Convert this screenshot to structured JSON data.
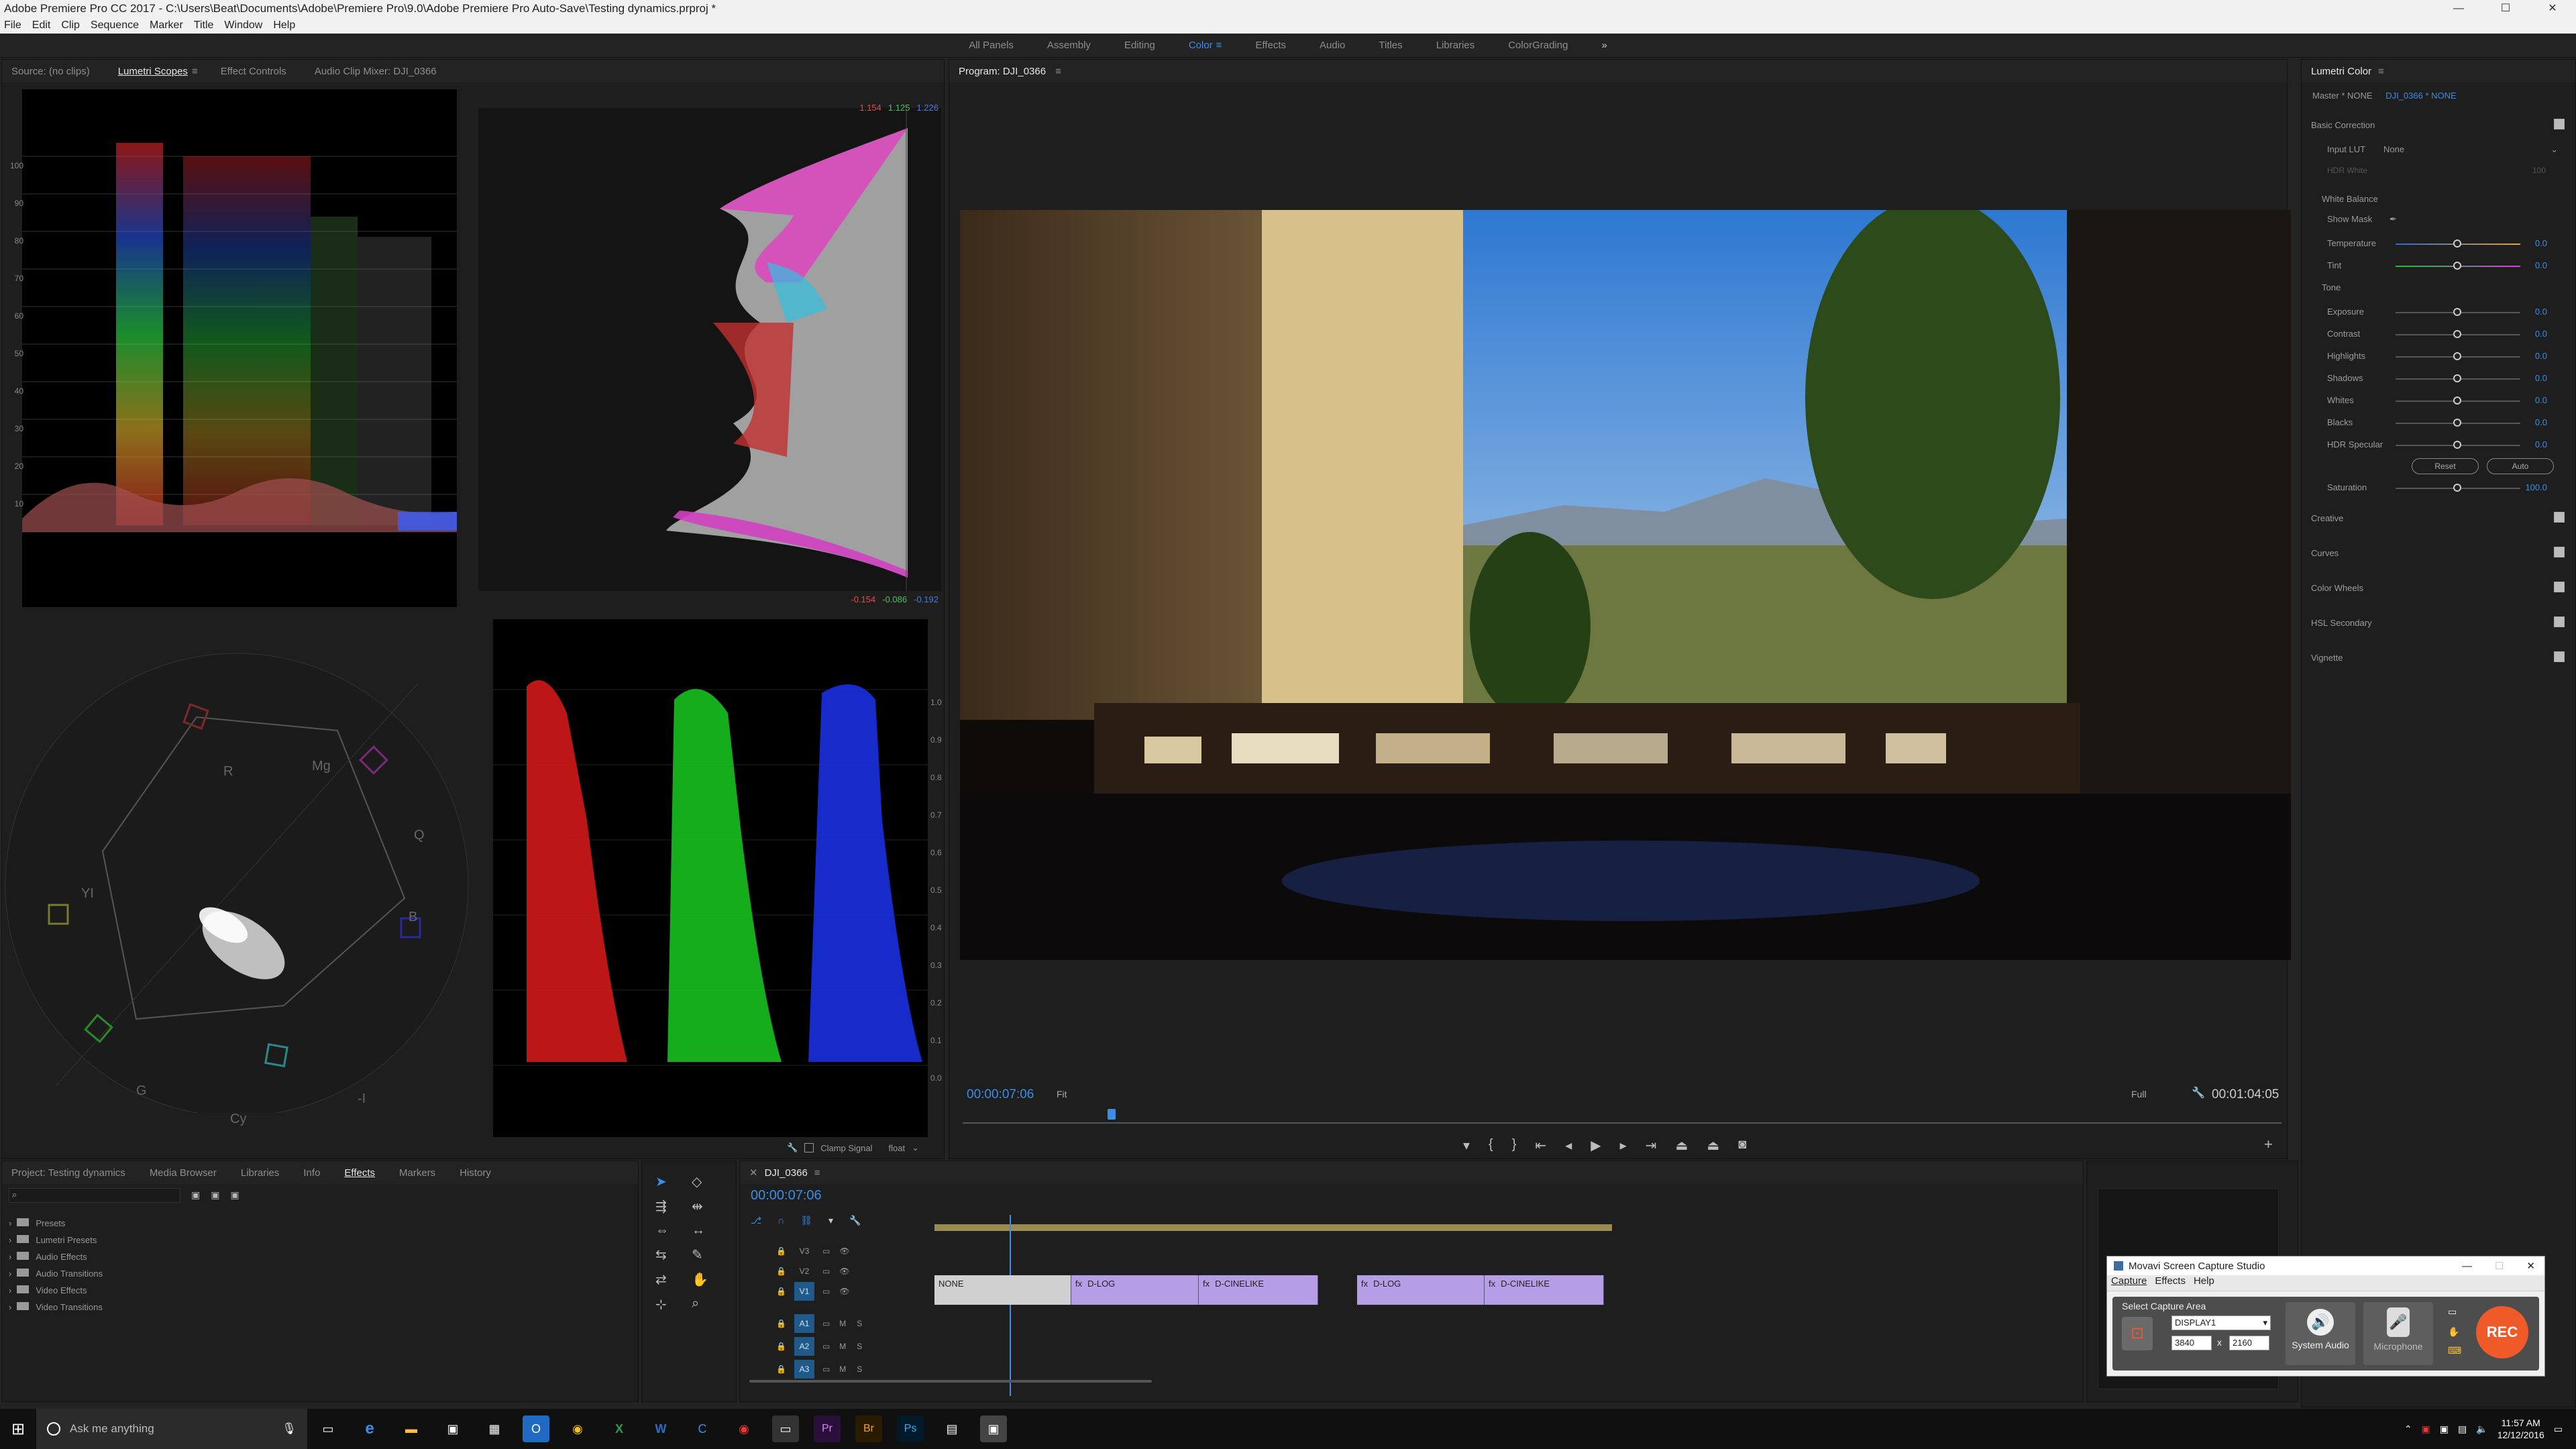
{
  "window": {
    "title": "Adobe Premiere Pro CC 2017 - C:\\Users\\Beat\\Documents\\Adobe\\Premiere Pro\\9.0\\Adobe Premiere Pro Auto-Save\\Testing dynamics.prproj *"
  },
  "menu": [
    "File",
    "Edit",
    "Clip",
    "Sequence",
    "Marker",
    "Title",
    "Window",
    "Help"
  ],
  "workspaces": [
    "All Panels",
    "Assembly",
    "Editing",
    "Color",
    "Effects",
    "Audio",
    "Titles",
    "Libraries",
    "ColorGrading"
  ],
  "workspaces_more": "»",
  "workspaces_menu": "≡",
  "panel_menu": "≡",
  "source_tabs": [
    "Source: (no clips)",
    "Lumetri Scopes",
    "Effect Controls",
    "Audio Clip Mixer: DJI_0366"
  ],
  "scopes": {
    "waveform_ticks_left": [
      "100",
      "90",
      "80",
      "70",
      "60",
      "50",
      "40",
      "30",
      "20",
      "10",
      "0"
    ],
    "parade_ticks": [
      "1.0",
      "0.9",
      "0.8",
      "0.7",
      "0.6",
      "0.5",
      "0.4",
      "0.3",
      "0.2",
      "0.1",
      "0.0"
    ],
    "histogram_top_values": [
      "1.154",
      "1.125",
      "1.226"
    ],
    "histogram_bottom_values": [
      "-0.154",
      "-0.086",
      "-0.192"
    ],
    "vector_labels": [
      "R",
      "Mg",
      "B",
      "Cy",
      "G",
      "YI"
    ],
    "vector_q_label": "Q",
    "vector_i_label": "-I",
    "clamp_signal": "Clamp Signal",
    "bit_depth": "float"
  },
  "program": {
    "title": "Program: DJI_0366",
    "timecode": "00:00:07:06",
    "fit": "Fit",
    "quality": "Full",
    "duration": "00:01:04:05"
  },
  "lumetri": {
    "title": "Lumetri Color",
    "master": "Master * NONE",
    "clip": "DJI_0366 * NONE",
    "basic_correction": "Basic Correction",
    "input_lut_label": "Input LUT",
    "input_lut_value": "None",
    "hdr_white": "HDR White",
    "hdr_white_value": "100",
    "white_balance": "White Balance",
    "show_mask": "Show Mask",
    "tone": "Tone",
    "wb_controls": [
      {
        "name": "Temperature",
        "value": "0.0"
      },
      {
        "name": "Tint",
        "value": "0.0"
      }
    ],
    "tone_controls": [
      {
        "name": "Exposure",
        "value": "0.0"
      },
      {
        "name": "Contrast",
        "value": "0.0"
      },
      {
        "name": "Highlights",
        "value": "0.0"
      },
      {
        "name": "Shadows",
        "value": "0.0"
      },
      {
        "name": "Whites",
        "value": "0.0"
      },
      {
        "name": "Blacks",
        "value": "0.0"
      },
      {
        "name": "HDR Specular",
        "value": "0.0"
      }
    ],
    "reset": "Reset",
    "auto": "Auto",
    "saturation_label": "Saturation",
    "saturation_value": "100.0",
    "sections": [
      "Creative",
      "Curves",
      "Color Wheels",
      "HSL Secondary",
      "Vignette"
    ]
  },
  "project": {
    "tabs": [
      "Project: Testing dynamics",
      "Media Browser",
      "Libraries",
      "Info",
      "Effects",
      "Markers",
      "History"
    ],
    "tree": [
      "Presets",
      "Lumetri Presets",
      "Audio Effects",
      "Audio Transitions",
      "Video Effects",
      "Video Transitions"
    ]
  },
  "timeline": {
    "title": "DJI_0366",
    "timecode": "00:00:07:06",
    "tracks": [
      "V3",
      "V2",
      "V1",
      "A1",
      "A2",
      "A3"
    ],
    "mute": "M",
    "solo": "S",
    "clips": [
      "NONE",
      "D-LOG",
      "D-CINELIKE",
      "D-LOG",
      "D-CINELIKE"
    ],
    "clip_fx": "fx"
  },
  "movavi": {
    "title": "Movavi Screen Capture Studio",
    "menu": [
      "Capture",
      "Effects",
      "Help"
    ],
    "select_area": "Select Capture Area",
    "display": "DISPLAY1",
    "width": "3840",
    "height": "2160",
    "times": "x",
    "system_audio": "System Audio",
    "microphone": "Microphone",
    "rec": "REC"
  },
  "taskbar": {
    "search": "Ask me anything",
    "time": "11:57 AM",
    "date": "12/12/2016",
    "apps": [
      "e",
      "Ps",
      "Pr",
      "Br",
      "X",
      "W"
    ]
  },
  "colors": {
    "accent": "#3a8ee6",
    "clip": "#b69ee6",
    "rec": "#f05a28"
  }
}
